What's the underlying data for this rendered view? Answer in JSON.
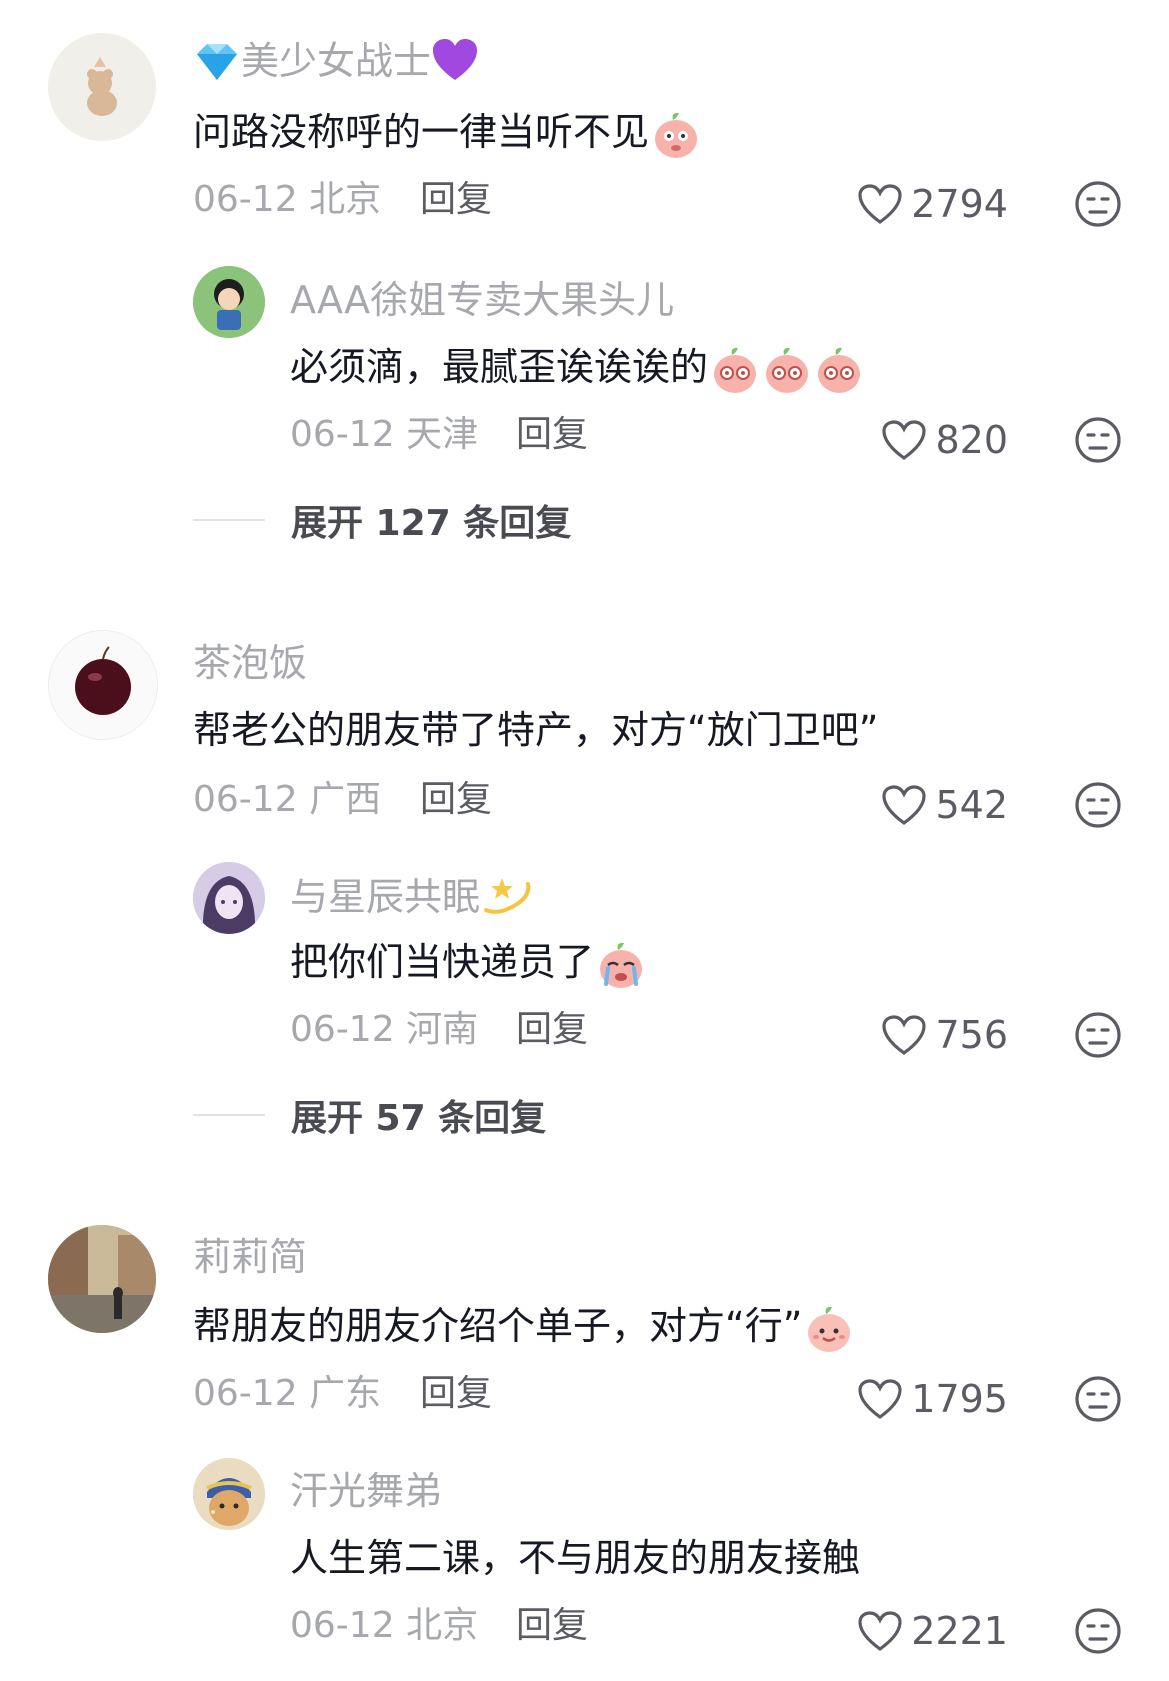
{
  "comments": [
    {
      "username": "美少女战士",
      "text": "问路没称呼的一律当听不见",
      "date": "06-12",
      "location": "北京",
      "reply_label": "回复",
      "likes": "2794",
      "replies": [
        {
          "username": "AAA徐姐专卖大果头儿",
          "text": "必须滴，最腻歪诶诶诶的",
          "date": "06-12",
          "location": "天津",
          "reply_label": "回复",
          "likes": "820"
        }
      ],
      "expand_label": "展开 127 条回复"
    },
    {
      "username": "茶泡饭",
      "text": "帮老公的朋友带了特产，对方“放门卫吧”",
      "date": "06-12",
      "location": "广西",
      "reply_label": "回复",
      "likes": "542",
      "replies": [
        {
          "username": "与星辰共眠",
          "text": "把你们当快递员了",
          "date": "06-12",
          "location": "河南",
          "reply_label": "回复",
          "likes": "756"
        }
      ],
      "expand_label": "展开 57 条回复"
    },
    {
      "username": "莉莉简",
      "text": "帮朋友的朋友介绍个单子，对方“行”",
      "date": "06-12",
      "location": "广东",
      "reply_label": "回复",
      "likes": "1795",
      "replies": [
        {
          "username": "汗光舞弟",
          "text": "人生第二课，不与朋友的朋友接触",
          "date": "06-12",
          "location": "北京",
          "reply_label": "回复",
          "likes": "2221"
        }
      ]
    }
  ],
  "colors": {
    "text": "#161823",
    "meta": "#a7a8ad",
    "icon": "#5b5c63"
  }
}
